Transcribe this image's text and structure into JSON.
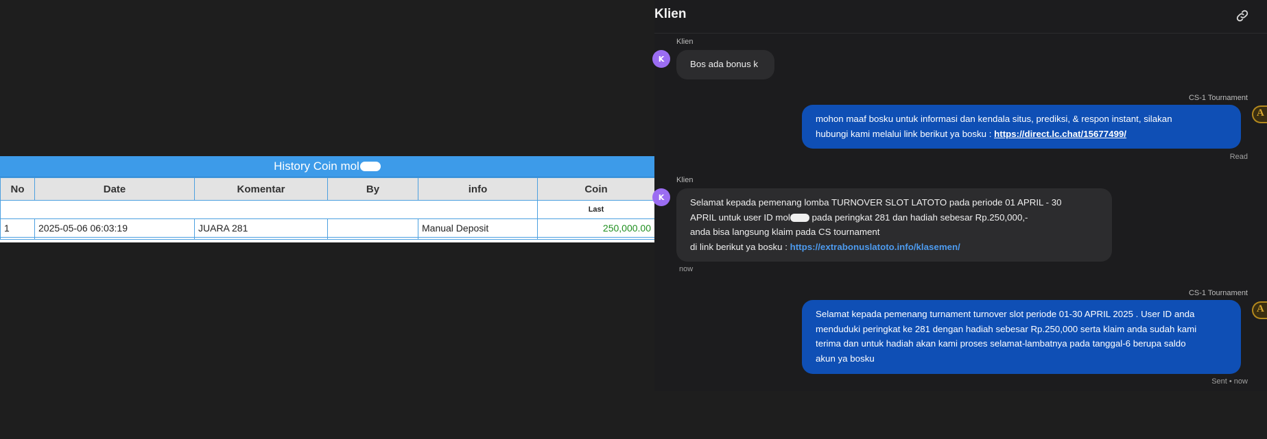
{
  "history": {
    "title": "History Coin mol",
    "columns": [
      "No",
      "Date",
      "Komentar",
      "By",
      "info",
      "Coin"
    ],
    "last_label": "Last",
    "rows": [
      {
        "no": "1",
        "date": "2025-05-06 06:03:19",
        "komentar": "JUARA 281",
        "by": "",
        "info": "Manual Deposit",
        "coin": "250,000.00"
      }
    ]
  },
  "chat": {
    "title": "Klien",
    "link_icon": "link-icon",
    "colors": {
      "bubble_in": "#2c2c2e",
      "bubble_out": "#0f4fb5",
      "avatar": "#9b6df2",
      "link": "#4d9bef"
    },
    "messages": [
      {
        "sender": "Klien",
        "avatar": "K",
        "direction": "in",
        "text": "Bos ada bonus k"
      },
      {
        "sender": "CS-1 Tournament",
        "direction": "out",
        "line1": "mohon maaf bosku untuk informasi dan kendala situs, prediksi, & respon instant, silakan",
        "line2": "hubungi kami melalui link berikut ya bosku : ",
        "link": "https://direct.lc.chat/15677499/",
        "status": "Read"
      },
      {
        "sender": "Klien",
        "avatar": "K",
        "direction": "in",
        "line1": "Selamat kepada pemenang lomba TURNOVER SLOT LATOTO pada periode 01 APRIL - 30",
        "line2a": "APRIL untuk user ID mol",
        "line2b": " pada peringkat 281 dan hadiah sebesar Rp.250,000,-",
        "line3": "anda bisa langsung klaim pada CS tournament",
        "line4": "di link berikut ya bosku : ",
        "link": "https://extrabonuslatoto.info/klasemen/",
        "status": "now"
      },
      {
        "sender": "CS-1 Tournament",
        "direction": "out",
        "lines": [
          "Selamat kepada pemenang turnament turnover slot periode 01-30 APRIL 2025 . User ID anda",
          "menduduki peringkat ke 281 dengan hadiah sebesar Rp.250,000 serta klaim anda sudah kami",
          "terima dan untuk hadiah akan kami proses selamat-lambatnya pada tanggal-6 berupa saldo",
          "akun ya bosku"
        ],
        "status": "Sent • now"
      }
    ]
  }
}
